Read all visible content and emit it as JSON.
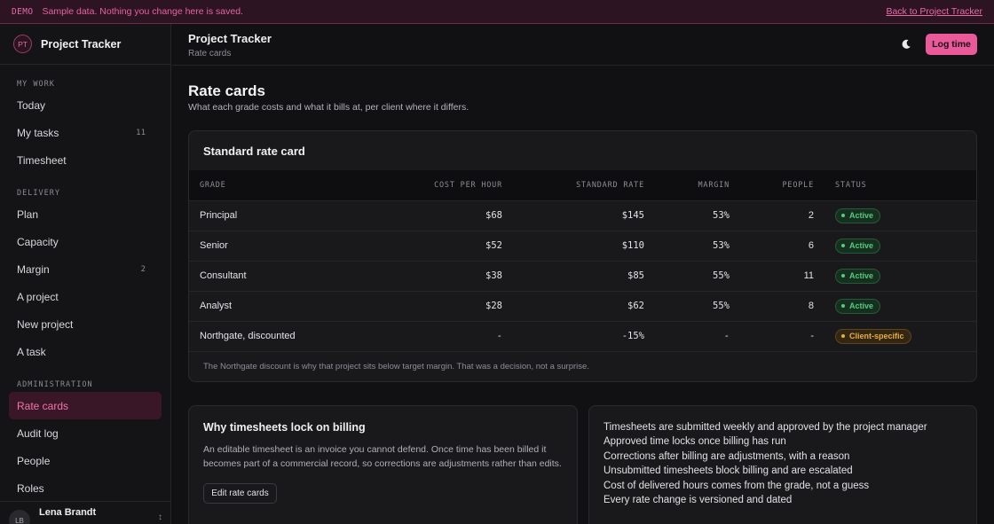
{
  "banner": {
    "tag": "DEMO",
    "message": "Sample data. Nothing you change here is saved.",
    "back_link": "Back to Project Tracker"
  },
  "sidebar": {
    "avatar_initials": "PT",
    "app_name": "Project Tracker",
    "sections": [
      {
        "label": "MY WORK",
        "items": [
          {
            "label": "Today",
            "count": ""
          },
          {
            "label": "My tasks",
            "count": "11"
          },
          {
            "label": "Timesheet",
            "count": ""
          }
        ]
      },
      {
        "label": "DELIVERY",
        "items": [
          {
            "label": "Plan",
            "count": ""
          },
          {
            "label": "Capacity",
            "count": ""
          },
          {
            "label": "Margin",
            "count": "2"
          },
          {
            "label": "A project",
            "count": ""
          },
          {
            "label": "New project",
            "count": ""
          },
          {
            "label": "A task",
            "count": ""
          }
        ]
      },
      {
        "label": "ADMINISTRATION",
        "items": [
          {
            "label": "Rate cards",
            "count": "",
            "active": true
          },
          {
            "label": "Audit log",
            "count": ""
          },
          {
            "label": "People",
            "count": ""
          },
          {
            "label": "Roles",
            "count": ""
          }
        ]
      }
    ],
    "user": {
      "initials": "LB",
      "name": "Lena Brandt"
    }
  },
  "header": {
    "title": "Project Tracker",
    "subtitle": "Rate cards",
    "theme_icon": "moon-icon",
    "log_time_label": "Log time"
  },
  "page": {
    "title": "Rate cards",
    "description": "What each grade costs and what it bills at, per client where it differs."
  },
  "rate_card": {
    "title": "Standard rate card",
    "columns": [
      "GRADE",
      "COST PER HOUR",
      "STANDARD RATE",
      "MARGIN",
      "PEOPLE",
      "STATUS"
    ],
    "rows": [
      {
        "grade": "Principal",
        "cost": "$68",
        "rate": "$145",
        "margin": "53%",
        "people": "2",
        "status": "Active",
        "status_kind": "active"
      },
      {
        "grade": "Senior",
        "cost": "$52",
        "rate": "$110",
        "margin": "53%",
        "people": "6",
        "status": "Active",
        "status_kind": "active"
      },
      {
        "grade": "Consultant",
        "cost": "$38",
        "rate": "$85",
        "margin": "55%",
        "people": "11",
        "status": "Active",
        "status_kind": "active"
      },
      {
        "grade": "Analyst",
        "cost": "$28",
        "rate": "$62",
        "margin": "55%",
        "people": "8",
        "status": "Active",
        "status_kind": "active"
      },
      {
        "grade": "Northgate, discounted",
        "cost": "-",
        "rate": "-15%",
        "margin": "-",
        "people": "-",
        "status": "Client-specific",
        "status_kind": "client"
      }
    ],
    "footnote": "The Northgate discount is why that project sits below target margin. That was a decision, not a surprise."
  },
  "why_panel": {
    "title": "Why timesheets lock on billing",
    "body": "An editable timesheet is an invoice you cannot defend. Once time has been billed it becomes part of a commercial record, so corrections are adjustments rather than edits.",
    "button_label": "Edit rate cards"
  },
  "rules_panel": {
    "items": [
      "Timesheets are submitted weekly and approved by the project manager",
      "Approved time locks once billing has run",
      "Corrections after billing are adjustments, with a reason",
      "Unsubmitted timesheets block billing and are escalated",
      "Cost of delivered hours comes from the grade, not a guess",
      "Every rate change is versioned and dated"
    ]
  },
  "colors": {
    "accent": "#ea5a9b",
    "active_status": "#58c97f",
    "client_status": "#e5ad47",
    "background": "#111113"
  }
}
